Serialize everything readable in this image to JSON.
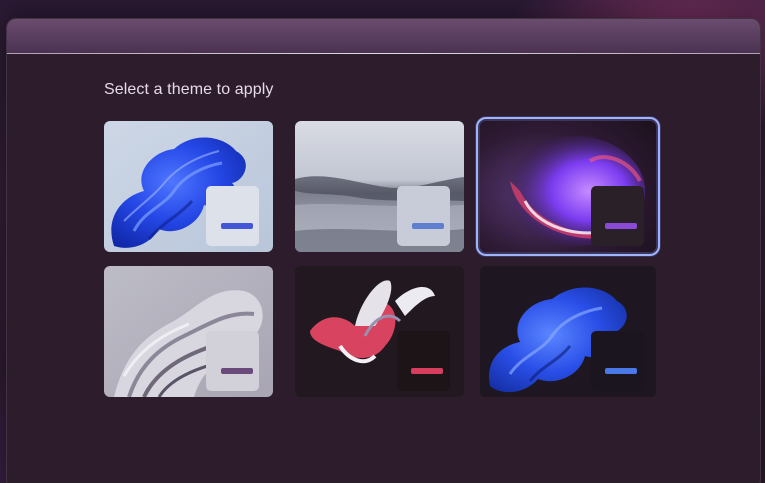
{
  "title": "Select a theme to apply",
  "themes": [
    {
      "name": "windows-light-bloom",
      "style": "light",
      "accent": "#4456d8",
      "selected": false
    },
    {
      "name": "glow-landscape",
      "style": "light",
      "accent": "#5f7fd0",
      "selected": false
    },
    {
      "name": "captured-motion",
      "style": "dark",
      "accent": "#8a4ad8",
      "selected": true
    },
    {
      "name": "sunrise-flow",
      "style": "light",
      "accent": "#6a4a7a",
      "selected": false
    },
    {
      "name": "flow-petals",
      "style": "dark",
      "accent": "#d83e5e",
      "selected": false
    },
    {
      "name": "windows-dark-bloom",
      "style": "dark",
      "accent": "#4a7ae8",
      "selected": false
    }
  ]
}
